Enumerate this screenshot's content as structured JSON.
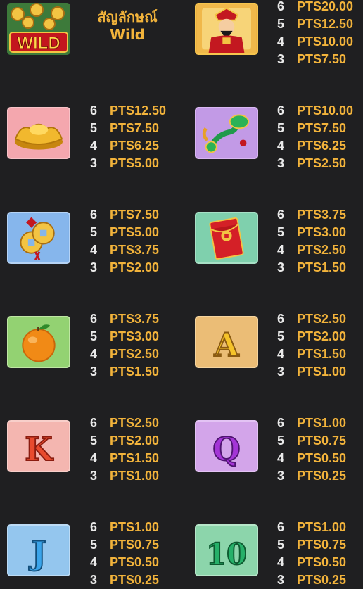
{
  "wild_label": [
    "สัญลักษณ์",
    "Wild"
  ],
  "wild_icon_text": "WILD",
  "symbols": [
    {
      "name": "wild",
      "payouts": []
    },
    {
      "name": "caishen",
      "payouts": [
        {
          "count": "6",
          "amount": "PTS20.00"
        },
        {
          "count": "5",
          "amount": "PTS12.50"
        },
        {
          "count": "4",
          "amount": "PTS10.00"
        },
        {
          "count": "3",
          "amount": "PTS7.50"
        }
      ]
    },
    {
      "name": "gold-ingot",
      "payouts": [
        {
          "count": "6",
          "amount": "PTS12.50"
        },
        {
          "count": "5",
          "amount": "PTS7.50"
        },
        {
          "count": "4",
          "amount": "PTS6.25"
        },
        {
          "count": "3",
          "amount": "PTS5.00"
        }
      ]
    },
    {
      "name": "jade-ruyi",
      "payouts": [
        {
          "count": "6",
          "amount": "PTS10.00"
        },
        {
          "count": "5",
          "amount": "PTS7.50"
        },
        {
          "count": "4",
          "amount": "PTS6.25"
        },
        {
          "count": "3",
          "amount": "PTS2.50"
        }
      ]
    },
    {
      "name": "coins",
      "payouts": [
        {
          "count": "6",
          "amount": "PTS7.50"
        },
        {
          "count": "5",
          "amount": "PTS5.00"
        },
        {
          "count": "4",
          "amount": "PTS3.75"
        },
        {
          "count": "3",
          "amount": "PTS2.00"
        }
      ]
    },
    {
      "name": "red-envelope",
      "payouts": [
        {
          "count": "6",
          "amount": "PTS3.75"
        },
        {
          "count": "5",
          "amount": "PTS3.00"
        },
        {
          "count": "4",
          "amount": "PTS2.50"
        },
        {
          "count": "3",
          "amount": "PTS1.50"
        }
      ]
    },
    {
      "name": "orange",
      "payouts": [
        {
          "count": "6",
          "amount": "PTS3.75"
        },
        {
          "count": "5",
          "amount": "PTS3.00"
        },
        {
          "count": "4",
          "amount": "PTS2.50"
        },
        {
          "count": "3",
          "amount": "PTS1.50"
        }
      ]
    },
    {
      "name": "letter-a",
      "payouts": [
        {
          "count": "6",
          "amount": "PTS2.50"
        },
        {
          "count": "5",
          "amount": "PTS2.00"
        },
        {
          "count": "4",
          "amount": "PTS1.50"
        },
        {
          "count": "3",
          "amount": "PTS1.00"
        }
      ]
    },
    {
      "name": "letter-k",
      "payouts": [
        {
          "count": "6",
          "amount": "PTS2.50"
        },
        {
          "count": "5",
          "amount": "PTS2.00"
        },
        {
          "count": "4",
          "amount": "PTS1.50"
        },
        {
          "count": "3",
          "amount": "PTS1.00"
        }
      ]
    },
    {
      "name": "letter-q",
      "payouts": [
        {
          "count": "6",
          "amount": "PTS1.00"
        },
        {
          "count": "5",
          "amount": "PTS0.75"
        },
        {
          "count": "4",
          "amount": "PTS0.50"
        },
        {
          "count": "3",
          "amount": "PTS0.25"
        }
      ]
    },
    {
      "name": "letter-j",
      "payouts": [
        {
          "count": "6",
          "amount": "PTS1.00"
        },
        {
          "count": "5",
          "amount": "PTS0.75"
        },
        {
          "count": "4",
          "amount": "PTS0.50"
        },
        {
          "count": "3",
          "amount": "PTS0.25"
        }
      ]
    },
    {
      "name": "number-10",
      "payouts": [
        {
          "count": "6",
          "amount": "PTS1.00"
        },
        {
          "count": "5",
          "amount": "PTS0.75"
        },
        {
          "count": "4",
          "amount": "PTS0.50"
        },
        {
          "count": "3",
          "amount": "PTS0.25"
        }
      ]
    }
  ],
  "letters": {
    "a": "A",
    "k": "K",
    "q": "Q",
    "j": "J",
    "ten": "10"
  },
  "colors": {
    "amount": "#f2b33b",
    "count": "#e9e9e9",
    "background": "#1f1f21"
  }
}
